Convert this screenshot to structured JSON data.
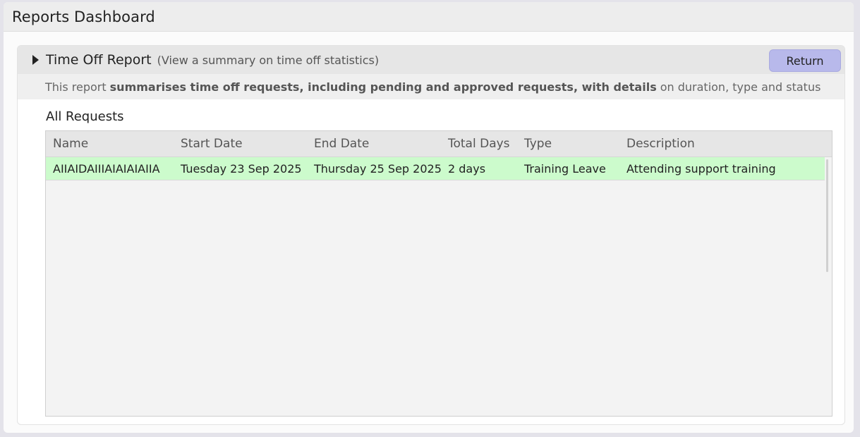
{
  "window": {
    "title": "Reports Dashboard"
  },
  "report": {
    "title": "Time Off Report",
    "subtitle": "(View a summary on time off statistics)",
    "return_label": "Return",
    "description": {
      "prefix": "This report",
      "bold": "summarises time off requests, including pending and approved requests, with details",
      "suffix": "on duration, type and status"
    }
  },
  "requests": {
    "title": "All Requests",
    "columns": [
      "Name",
      "Start Date",
      "End Date",
      "Total Days",
      "Type",
      "Description"
    ],
    "rows": [
      {
        "name": "AIIAIDAIIIAIAIAIAIIA",
        "start_date": "Tuesday 23 Sep 2025",
        "end_date": "Thursday 25 Sep 2025",
        "total_days": "2 days",
        "type": "Training Leave",
        "description": "Attending support training",
        "status_color": "#ccfbcc"
      }
    ]
  },
  "colors": {
    "accent_button": "#b8b9eb",
    "approved_row": "#ccfbcc"
  }
}
